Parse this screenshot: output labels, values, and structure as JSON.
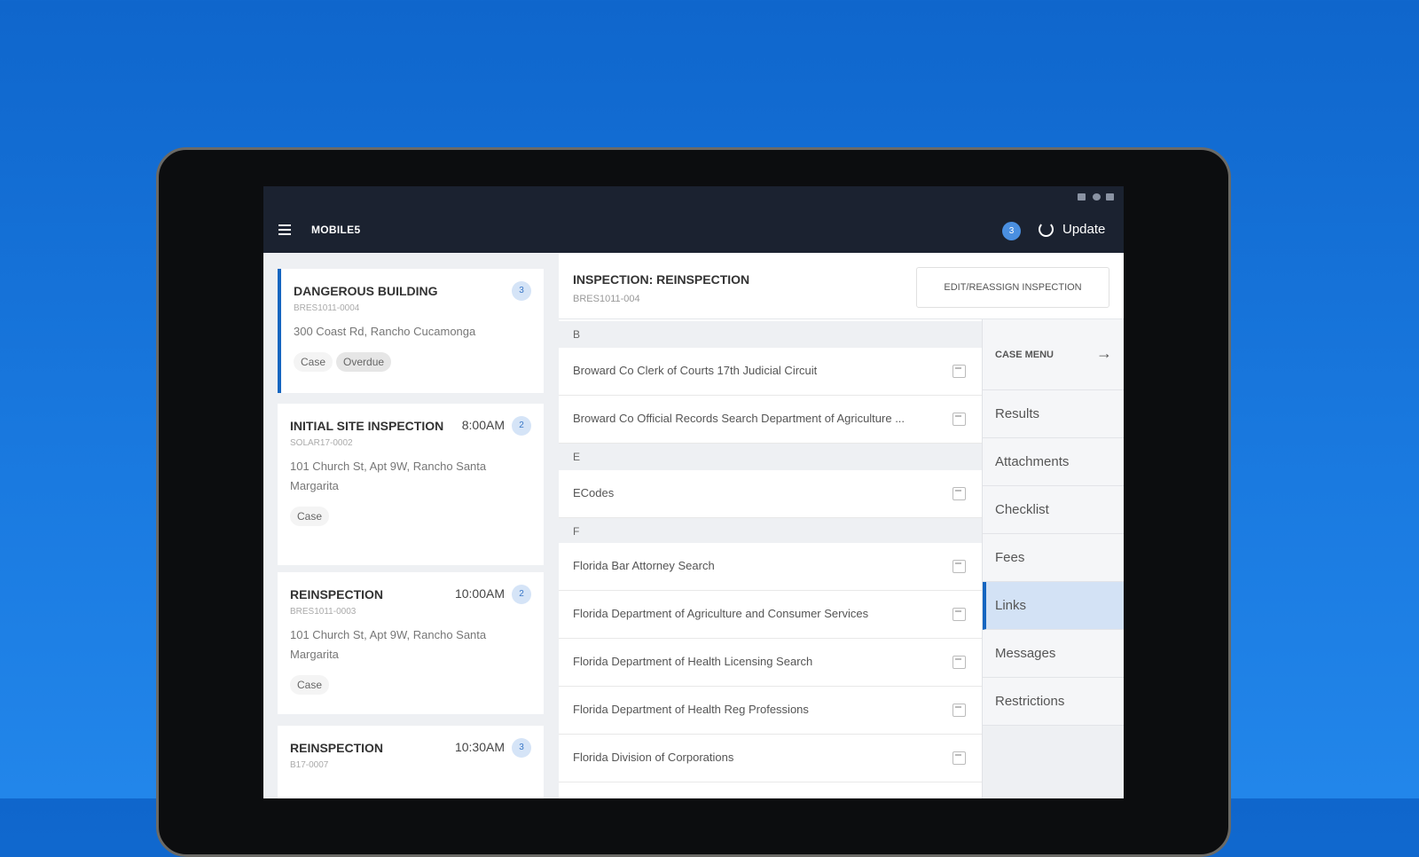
{
  "app": {
    "title": "MOBILE5",
    "notification_count": "3",
    "update_label": "Update"
  },
  "cards": [
    {
      "title": "DANGEROUS BUILDING",
      "time": "",
      "count": "3",
      "id": "BRES1011-0004",
      "address": "300 Coast Rd, Rancho Cucamonga",
      "tags": [
        "Case",
        "Overdue"
      ]
    },
    {
      "title": "INITIAL SITE INSPECTION",
      "time": "8:00AM",
      "count": "2",
      "id": "SOLAR17-0002",
      "address": "101 Church St, Apt 9W, Rancho Santa Margarita",
      "tags": [
        "Case"
      ]
    },
    {
      "title": "REINSPECTION",
      "time": "10:00AM",
      "count": "2",
      "id": "BRES1011-0003",
      "address": "101 Church St, Apt 9W, Rancho Santa Margarita",
      "tags": [
        "Case"
      ]
    },
    {
      "title": "REINSPECTION",
      "time": "10:30AM",
      "count": "3",
      "id": "B17-0007"
    }
  ],
  "detail": {
    "title": "INSPECTION: REINSPECTION",
    "id": "BRES1011-004",
    "edit_button": "EDIT/REASSIGN INSPECTION"
  },
  "links": {
    "sections": [
      "B",
      "E",
      "F"
    ],
    "items": [
      "Broward Co Clerk of Courts 17th Judicial Circuit",
      "Broward Co Official Records Search Department of Agriculture ...",
      "ECodes",
      "Florida Bar Attorney Search",
      "Florida Department of Agriculture and Consumer Services",
      "Florida Department of Health Licensing Search",
      "Florida Department of Health Reg Professions",
      "Florida Division of Corporations"
    ]
  },
  "case_menu": {
    "title": "CASE MENU",
    "items": [
      "Results",
      "Attachments",
      "Checklist",
      "Fees",
      "Links",
      "Messages",
      "Restrictions"
    ],
    "selected": "Links"
  }
}
